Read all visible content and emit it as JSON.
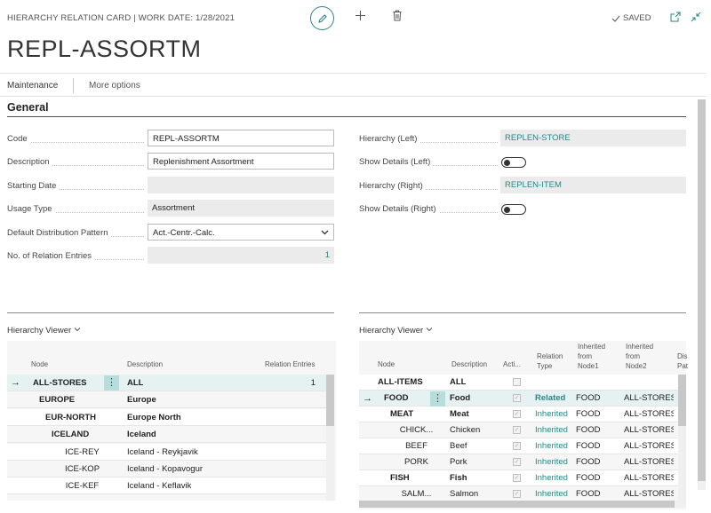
{
  "header": {
    "breadcrumb": "HIERARCHY RELATION CARD | WORK DATE: 1/28/2021",
    "saved_label": "SAVED",
    "title": "REPL-ASSORTM"
  },
  "actionbar": {
    "maintenance": "Maintenance",
    "more": "More options"
  },
  "section": {
    "general": "General"
  },
  "fields": {
    "code": {
      "label": "Code",
      "value": "REPL-ASSORTM"
    },
    "description": {
      "label": "Description",
      "value": "Replenishment Assortment"
    },
    "starting_date": {
      "label": "Starting Date",
      "value": ""
    },
    "usage_type": {
      "label": "Usage Type",
      "value": "Assortment"
    },
    "distribution_pattern": {
      "label": "Default Distribution Pattern",
      "value": "Act.-Centr.-Calc."
    },
    "relation_entries": {
      "label": "No. of Relation Entries",
      "value": "1"
    },
    "hierarchy_left": {
      "label": "Hierarchy (Left)",
      "value": "REPLEN-STORE"
    },
    "show_details_left": {
      "label": "Show Details (Left)"
    },
    "hierarchy_right": {
      "label": "Hierarchy (Right)",
      "value": "REPLEN-ITEM"
    },
    "show_details_right": {
      "label": "Show Details (Right)"
    }
  },
  "left_viewer": {
    "title": "Hierarchy Viewer",
    "columns": {
      "node": "Node",
      "description": "Description",
      "relation_entries": "Relation Entries"
    },
    "rows": [
      {
        "node": "ALL-STORES",
        "description": "ALL",
        "entries": "1"
      },
      {
        "node": "EUROPE",
        "description": "Europe",
        "entries": ""
      },
      {
        "node": "EUR-NORTH",
        "description": "Europe North",
        "entries": ""
      },
      {
        "node": "ICELAND",
        "description": "Iceland",
        "entries": ""
      },
      {
        "node": "ICE-REY",
        "description": "Iceland - Reykjavik",
        "entries": ""
      },
      {
        "node": "ICE-KOP",
        "description": "Iceland - Kopavogur",
        "entries": ""
      },
      {
        "node": "ICE-KEF",
        "description": "Iceland - Keflavik",
        "entries": ""
      }
    ]
  },
  "right_viewer": {
    "title": "Hierarchy Viewer",
    "columns": {
      "node": "Node",
      "description": "Description",
      "active": "Acti...",
      "relation_type_1": "Relation",
      "relation_type_2": "Type",
      "inh1_1": "Inherited",
      "inh1_2": "from",
      "inh1_3": "Node1",
      "inh2_1": "Inherited",
      "inh2_2": "from",
      "inh2_3": "Node2",
      "dis_1": "Dis",
      "dis_2": "Pat"
    },
    "rows": [
      {
        "node": "ALL-ITEMS",
        "description": "ALL",
        "rel": "",
        "n1": "",
        "n2": ""
      },
      {
        "node": "FOOD",
        "description": "Food",
        "rel": "Related",
        "n1": "FOOD",
        "n2": "ALL-STORES"
      },
      {
        "node": "MEAT",
        "description": "Meat",
        "rel": "Inherited",
        "n1": "FOOD",
        "n2": "ALL-STORES"
      },
      {
        "node": "CHICK...",
        "description": "Chicken",
        "rel": "Inherited",
        "n1": "FOOD",
        "n2": "ALL-STORES"
      },
      {
        "node": "BEEF",
        "description": "Beef",
        "rel": "Inherited",
        "n1": "FOOD",
        "n2": "ALL-STORES"
      },
      {
        "node": "PORK",
        "description": "Pork",
        "rel": "Inherited",
        "n1": "FOOD",
        "n2": "ALL-STORES"
      },
      {
        "node": "FISH",
        "description": "Fish",
        "rel": "Inherited",
        "n1": "FOOD",
        "n2": "ALL-STORES"
      },
      {
        "node": "SALM...",
        "description": "Salmon",
        "rel": "Inherited",
        "n1": "FOOD",
        "n2": "ALL-STORES"
      }
    ]
  },
  "colors": {
    "accent": "#2a8686",
    "readonly_bg": "#ebebeb"
  },
  "icons": [
    "edit-icon",
    "add-icon",
    "delete-icon",
    "check-icon",
    "open-new-window-icon",
    "collapse-icon",
    "chevron-down-icon",
    "arrow-right-icon",
    "more-dots-icon"
  ]
}
